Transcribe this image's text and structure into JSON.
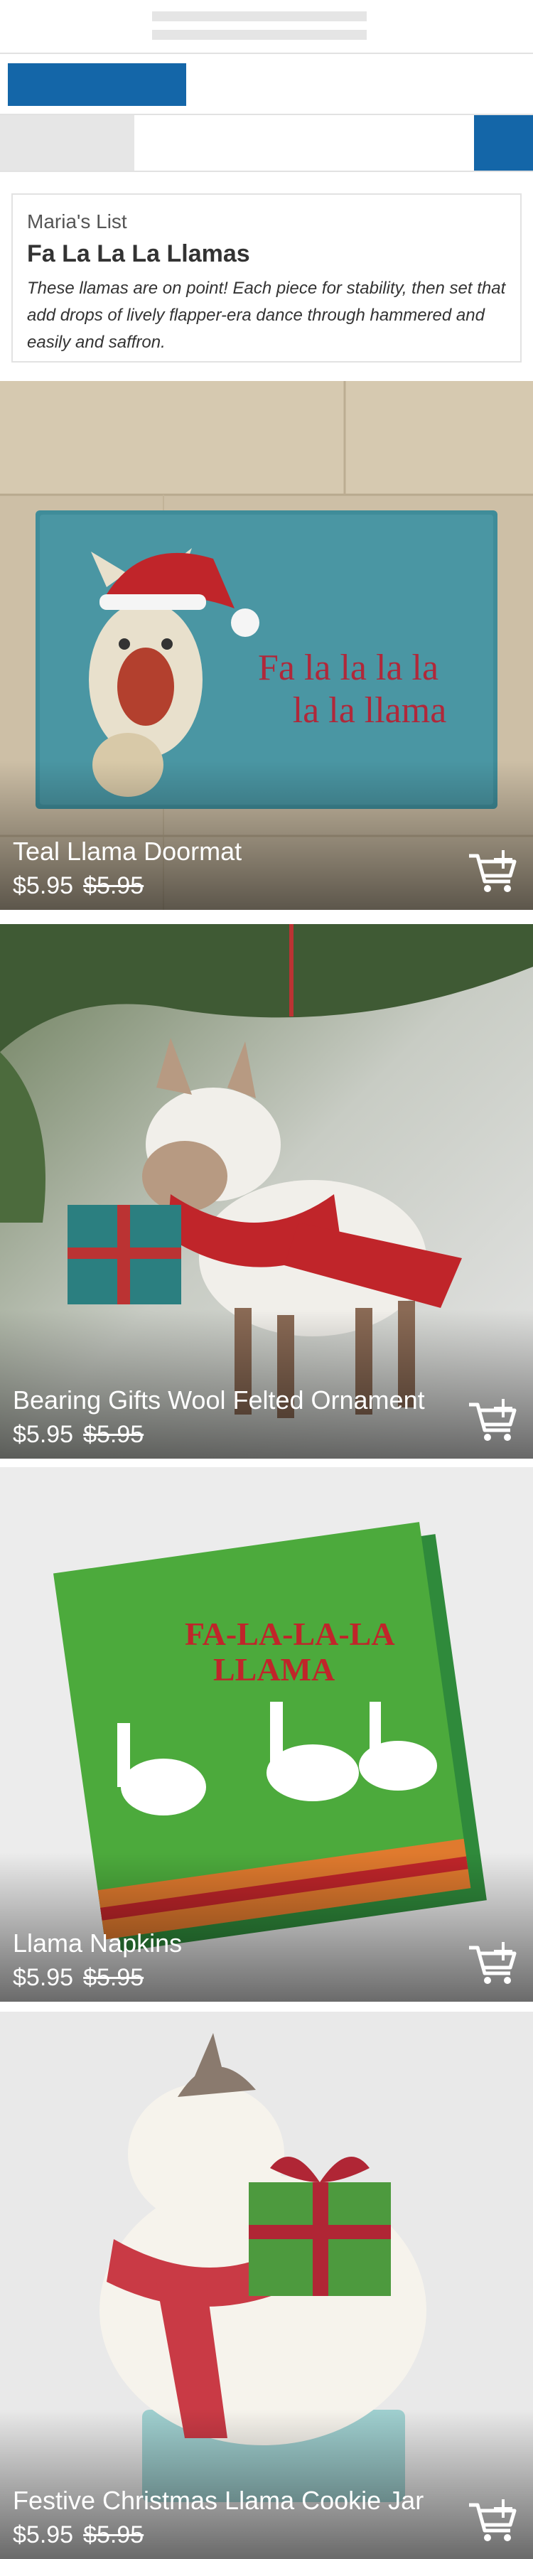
{
  "header": {
    "skeleton_lines": 2
  },
  "list": {
    "owner": "Maria's List",
    "title": "Fa La La La Llamas",
    "description": "These llamas are on point! Each piece for stability, then set that add drops of lively flapper-era dance through hammered and easily and saffron."
  },
  "products": [
    {
      "name": "Teal Llama Doormat",
      "price": "$5.95",
      "original_price": "$5.95",
      "mat_text_line1": "Fa la la la la",
      "mat_text_line2": "la la llama"
    },
    {
      "name": "Bearing Gifts Wool Felted Ornament",
      "price": "$5.95",
      "original_price": "$5.95"
    },
    {
      "name": "Llama Napkins",
      "price": "$5.95",
      "original_price": "$5.95",
      "napkin_text_line1": "FA-LA-LA-LA",
      "napkin_text_line2": "LLAMA"
    },
    {
      "name": "Festive Christmas Llama Cookie Jar",
      "price": "$5.95",
      "original_price": "$5.95"
    }
  ],
  "icons": {
    "cart": "add-to-cart-icon"
  },
  "colors": {
    "accent_blue": "#1466a8",
    "doormat_teal": "#3f8c99",
    "napkin_green": "#4caa3c",
    "scarf_red": "#c0252a"
  }
}
